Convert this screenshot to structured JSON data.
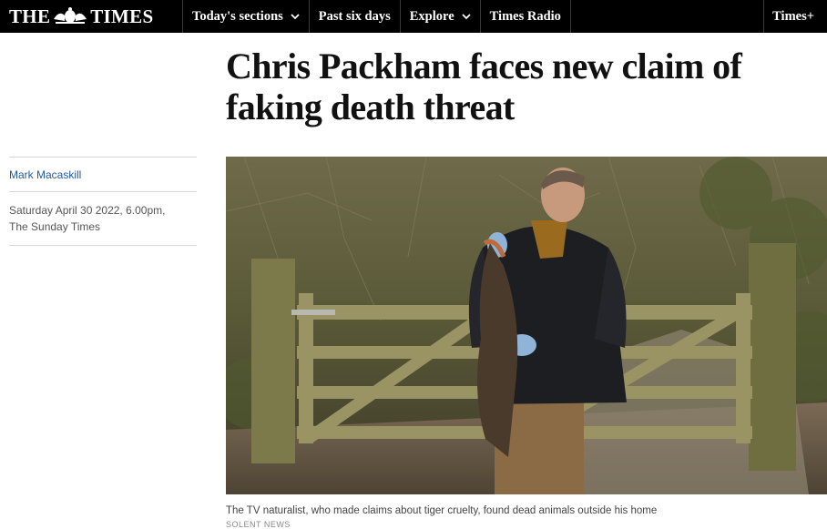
{
  "nav": {
    "logo_left": "THE",
    "logo_right": "TIMES",
    "items": [
      {
        "label": "Today's sections"
      },
      {
        "label": "Past six days"
      },
      {
        "label": "Explore"
      },
      {
        "label": "Times Radio"
      }
    ],
    "right_label": "Times+"
  },
  "article": {
    "headline": "Chris Packham faces new claim of faking death threat",
    "author": "Mark Macaskill",
    "date": "Saturday April 30 2022, 6.00pm,",
    "publication": "The Sunday Times",
    "caption": "The TV naturalist, who made claims about tiger cruelty, found dead animals outside his home",
    "credit": "SOLENT NEWS"
  },
  "colors": {
    "nav_bg": "#000000",
    "link": "#1f5aa5",
    "headline": "#111111"
  },
  "icons": [
    "crest-icon",
    "chevron-down-icon"
  ]
}
